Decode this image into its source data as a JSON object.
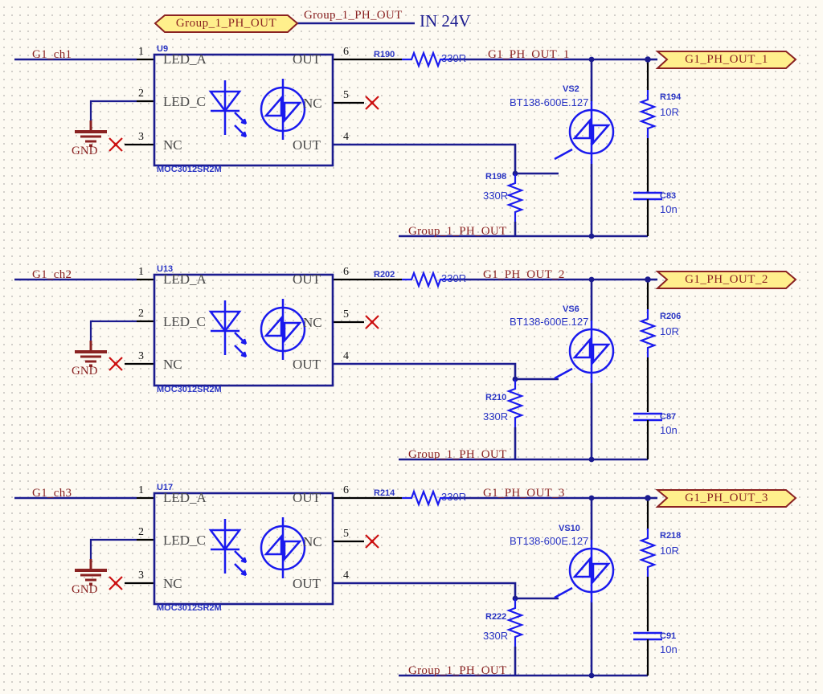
{
  "sheet": {
    "title_port_top": "Group_1_PH_OUT",
    "top_net_label": "Group_1_PH_OUT",
    "top_supply_label": "IN 24V"
  },
  "blocks": [
    {
      "id": "block1",
      "input_net": "G1_ch1",
      "gnd_label": "GND",
      "ic": {
        "refdes": "U9",
        "part": "MOC3012SR2M",
        "pins": [
          {
            "num": "1",
            "name": "LED_A"
          },
          {
            "num": "2",
            "name": "LED_C"
          },
          {
            "num": "3",
            "name": "NC"
          },
          {
            "num": "6",
            "name": "OUT"
          },
          {
            "num": "5",
            "name": "NC"
          },
          {
            "num": "4",
            "name": "OUT"
          }
        ]
      },
      "series_resistor": {
        "refdes": "R190",
        "value": "330R"
      },
      "out_net": "G1_PH_OUT_1",
      "triac": {
        "refdes": "VS2",
        "part": "BT138-600E.127"
      },
      "gate_resistor": {
        "refdes": "R198",
        "value": "330R"
      },
      "snubber_resistor": {
        "refdes": "R194",
        "value": "10R"
      },
      "snubber_cap": {
        "refdes": "C83",
        "value": "10n"
      },
      "bottom_net": "Group_1_PH_OUT",
      "port": "G1_PH_OUT_1"
    },
    {
      "id": "block2",
      "input_net": "G1_ch2",
      "gnd_label": "GND",
      "ic": {
        "refdes": "U13",
        "part": "MOC3012SR2M",
        "pins": [
          {
            "num": "1",
            "name": "LED_A"
          },
          {
            "num": "2",
            "name": "LED_C"
          },
          {
            "num": "3",
            "name": "NC"
          },
          {
            "num": "6",
            "name": "OUT"
          },
          {
            "num": "5",
            "name": "NC"
          },
          {
            "num": "4",
            "name": "OUT"
          }
        ]
      },
      "series_resistor": {
        "refdes": "R202",
        "value": "330R"
      },
      "out_net": "G1_PH_OUT_2",
      "triac": {
        "refdes": "VS6",
        "part": "BT138-600E.127"
      },
      "gate_resistor": {
        "refdes": "R210",
        "value": "330R"
      },
      "snubber_resistor": {
        "refdes": "R206",
        "value": "10R"
      },
      "snubber_cap": {
        "refdes": "C87",
        "value": "10n"
      },
      "bottom_net": "Group_1_PH_OUT",
      "port": "G1_PH_OUT_2"
    },
    {
      "id": "block3",
      "input_net": "G1_ch3",
      "gnd_label": "GND",
      "ic": {
        "refdes": "U17",
        "part": "MOC3012SR2M",
        "pins": [
          {
            "num": "1",
            "name": "LED_A"
          },
          {
            "num": "2",
            "name": "LED_C"
          },
          {
            "num": "3",
            "name": "NC"
          },
          {
            "num": "6",
            "name": "OUT"
          },
          {
            "num": "5",
            "name": "NC"
          },
          {
            "num": "4",
            "name": "OUT"
          }
        ]
      },
      "series_resistor": {
        "refdes": "R214",
        "value": "330R"
      },
      "out_net": "G1_PH_OUT_3",
      "triac": {
        "refdes": "VS10",
        "part": "BT138-600E.127"
      },
      "gate_resistor": {
        "refdes": "R222",
        "value": "330R"
      },
      "snubber_resistor": {
        "refdes": "R218",
        "value": "10R"
      },
      "snubber_cap": {
        "refdes": "C91",
        "value": "10n"
      },
      "bottom_net": "Group_1_PH_OUT",
      "port": "G1_PH_OUT_3"
    }
  ],
  "colors": {
    "wire_blue": "#1b1b8f",
    "wire_black": "#000000",
    "symbol_blue": "#1a1aee",
    "text_red": "#8a2222",
    "port_fill": "#ffef8c",
    "port_border": "#8a2222",
    "gnd_red": "#8a2222",
    "nc_cross": "#cc1111",
    "background": "#fdfaf2"
  }
}
